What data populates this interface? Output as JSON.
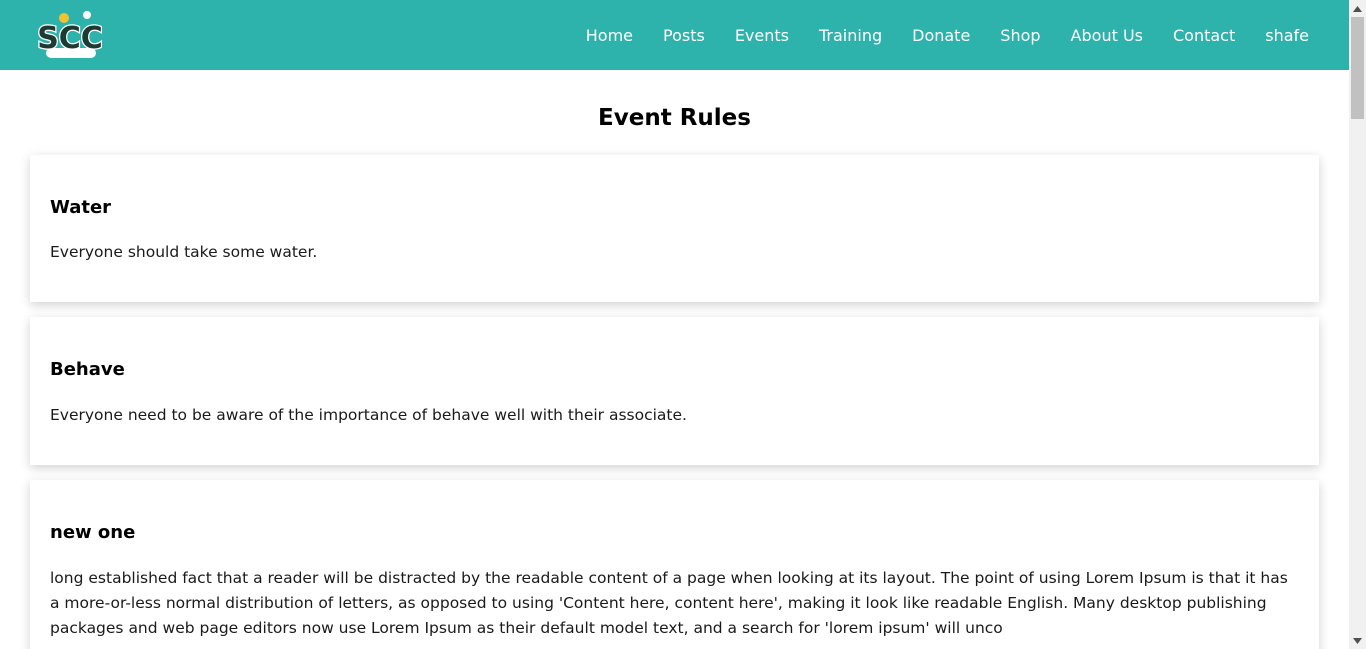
{
  "nav": {
    "logo_text": "SCC",
    "links": [
      "Home",
      "Posts",
      "Events",
      "Training",
      "Donate",
      "Shop",
      "About Us",
      "Contact",
      "shafe"
    ]
  },
  "page": {
    "title": "Event Rules"
  },
  "rules": [
    {
      "title": "Water",
      "body": "Everyone should take some water."
    },
    {
      "title": "Behave",
      "body": "Everyone need to be aware of the importance of behave well with their associate."
    },
    {
      "title": "new one",
      "body": "long established fact that a reader will be distracted by the readable content of a page when looking at its layout. The point of using Lorem Ipsum is that it has a more-or-less normal distribution of letters, as opposed to using 'Content here, content here', making it look like readable English. Many desktop publishing packages and web page editors now use Lorem Ipsum as their default model text, and a search for 'lorem ipsum' will unco"
    }
  ],
  "colors": {
    "navbar": "#2eb2ac",
    "logo_dark": "#1d3b33",
    "logo_yellow": "#f2c230"
  }
}
